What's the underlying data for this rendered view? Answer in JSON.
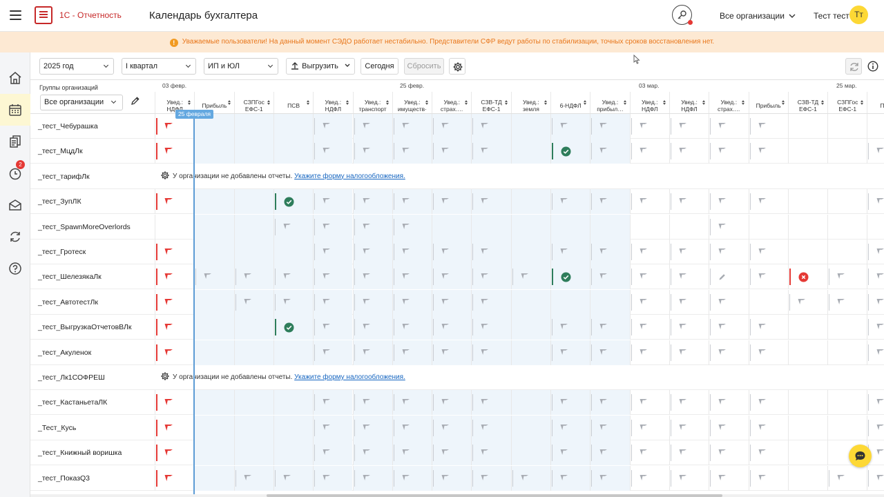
{
  "header": {
    "logo_text": "1С - Отчетность",
    "title": "Календарь бухгалтера",
    "org_selector": "Все организации",
    "user_name": "Тест тест",
    "avatar_initials": "Тт"
  },
  "alert": {
    "text": "Уважаемые пользователи! На данный момент СЭДО работает нестабильно. Представители СФР ведут работы по стабилизации, точных сроков восстановления нет."
  },
  "sidebar": {
    "badge_count": "2",
    "items": [
      "home-icon",
      "calendar-icon",
      "documents-icon",
      "clock-icon",
      "mail-icon",
      "sync-icon",
      "help-icon"
    ]
  },
  "toolbar": {
    "year": "2025 год",
    "quarter": "I квартал",
    "org_type": "ИП и ЮЛ",
    "export_label": "Выгрузить",
    "today_label": "Сегодня",
    "reset_label": "Сбросить"
  },
  "grid": {
    "groups_label": "Группы организаций",
    "groups_value": "Все организации",
    "today_badge": "25 февраля",
    "dates": [
      "03 февр.",
      "25 февр.",
      "03 мар.",
      "25 мар."
    ],
    "columns": [
      [
        "Увед.:",
        "НДФЛ"
      ],
      [
        "Прибыль",
        ""
      ],
      [
        "СЗПГос",
        "ЕФС-1"
      ],
      [
        "ПСВ",
        ""
      ],
      [
        "Увед.:",
        "НДФЛ"
      ],
      [
        "Увед.:",
        "транспорт"
      ],
      [
        "Увед.:",
        "имуществ·"
      ],
      [
        "Увед.:",
        "страх.…"
      ],
      [
        "СЗВ-ТД",
        "ЕФС-1"
      ],
      [
        "Увед.:",
        "земля"
      ],
      [
        "6-НДФЛ",
        ""
      ],
      [
        "Увед.:",
        "прибыл…"
      ],
      [
        "Увед.:",
        "НДФЛ"
      ],
      [
        "Увед.:",
        "НДФЛ"
      ],
      [
        "Увед.:",
        "страх.…"
      ],
      [
        "Прибыль",
        ""
      ],
      [
        "СЗВ-ТД",
        "ЕФС-1"
      ],
      [
        "СЗПГос",
        "ЕФС-1"
      ],
      [
        "Приб",
        ""
      ]
    ],
    "notice_text": "У организации не добавлены отчеты.",
    "notice_link": "Укажите форму налогообложения.",
    "rows": [
      {
        "name": "_тест_Чебурашка",
        "cells": "R...PPPPP.PPPPPP..."
      },
      {
        "name": "_тест_МцдЛк",
        "cells": "R...PPPPP.OPPPPP..P"
      },
      {
        "name": "_тест_тарифЛк",
        "notice": true
      },
      {
        "name": "_тест_ЗупЛК",
        "cells": "R..OPPPPP.PPPPPP..P"
      },
      {
        "name": "_тест_SpawnMoreOverlords",
        "cells": "...PPPP.......P...."
      },
      {
        "name": "_тест_Гротеск",
        "cells": "R...PPPPP.PPPPPP..P"
      },
      {
        "name": "_тест_ШелезякаЛк",
        "cells": "RPPPPPPPPPOPPPEPXPP"
      },
      {
        "name": "_тест_АвтотестЛк",
        "cells": "R.PPPPPPP...PPP.PPP"
      },
      {
        "name": "_тест_ВыгрузкаОтчетовВЛк",
        "cells": "R..OPPPPP.PPPPPP..P"
      },
      {
        "name": "_тест_Акуленок",
        "cells": "R...PPPPP.PPPPPP..P"
      },
      {
        "name": "_тест_Лк1СОФРЕШ",
        "notice": true
      },
      {
        "name": "_тест_КастаньетаЛК",
        "cells": "R...PPPPP.PPPPPP..P"
      },
      {
        "name": "_Тест_Кусь",
        "cells": "R...PPPPP.PPPPPP..P"
      },
      {
        "name": "_тест_Книжный воришка",
        "cells": "R...PPPPP.PPPPPP..P"
      },
      {
        "name": "_тест_ПоказQ3",
        "cells": "R.PPPPPPPPPPPPPP.PPP"
      }
    ]
  },
  "colors": {
    "brand_red": "#c62828",
    "accent_yellow": "#fdd835",
    "alert_bg": "#fde9d3",
    "alert_text": "#e8761a",
    "ok_green": "#2e7d5b",
    "error_red": "#e53935",
    "today_blue": "#5b9bd5"
  }
}
